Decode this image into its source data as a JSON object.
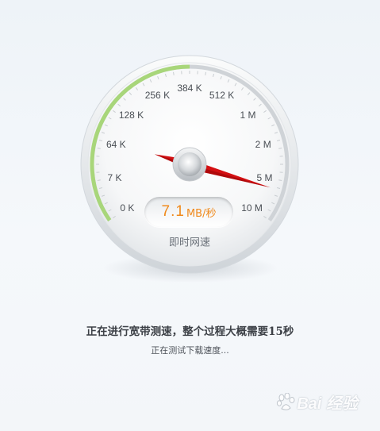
{
  "gauge": {
    "scale_labels": [
      "0 K",
      "7 K",
      "64 K",
      "128 K",
      "256 K",
      "384 K",
      "512 K",
      "1 M",
      "2 M",
      "5 M",
      "10 M"
    ],
    "progress_fraction": 0.5,
    "speed_value": "7.1",
    "speed_unit": "MB/秒",
    "caption": "即时网速",
    "accent_color": "#a8d67a",
    "needle_color": "#d40f12",
    "speed_color": "#f08a1c"
  },
  "status": {
    "title": "正在进行宽带测速，整个过程大概需要15秒",
    "subtitle": "正在测试下载速度..."
  },
  "watermark": {
    "text": "Bai 经验"
  }
}
